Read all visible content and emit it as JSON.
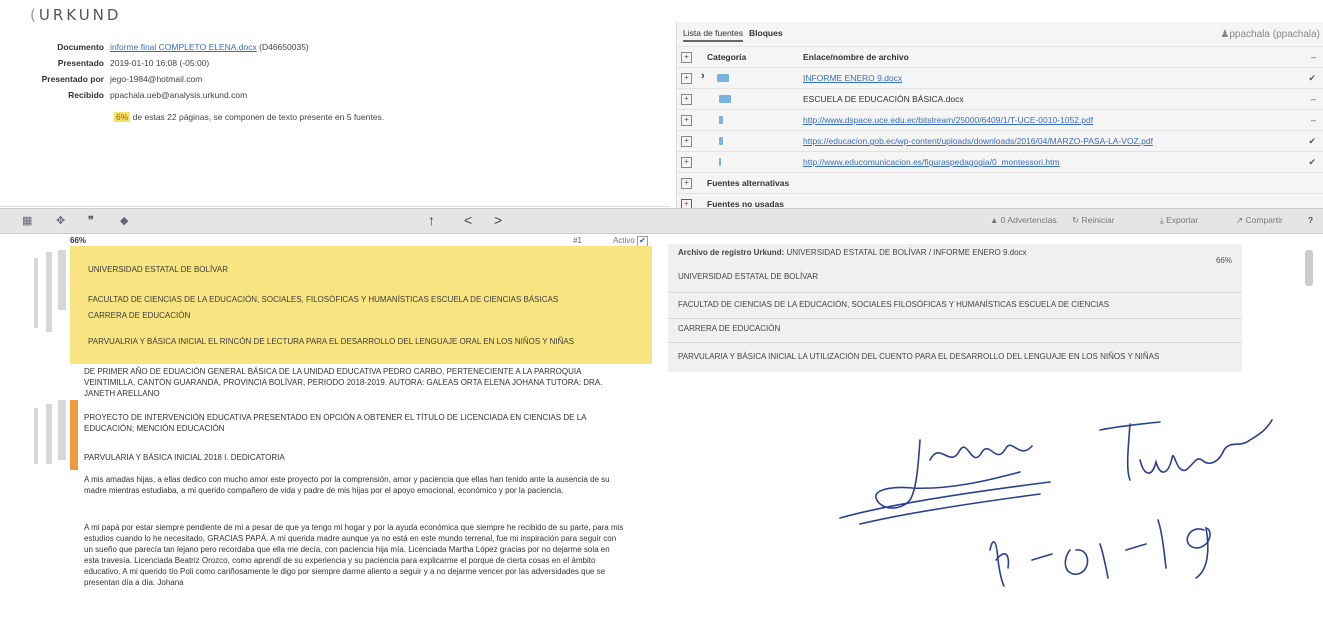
{
  "app": {
    "logo": "URKUND"
  },
  "meta": {
    "documento_label": "Documento",
    "documento_value": "informe final COMPLETO ELENA.docx",
    "documento_id": "(D46650035)",
    "presentado_label": "Presentado",
    "presentado_value": "2019-01-10 16:08 (-05:00)",
    "presentado_por_label": "Presentado por",
    "presentado_por_value": "jego-1984@hotmail.com",
    "recibido_label": "Recibido",
    "recibido_value": "ppachala.ueb@analysis.urkund.com",
    "summary_pct": "6%",
    "summary_text": "de estas 22 páginas, se componen de texto presente en 5 fuentes."
  },
  "sources": {
    "tab_list": "Lista de fuentes",
    "tab_blocks": "Bloques",
    "user": "ppachala (ppachala)",
    "col_category": "Categoría",
    "col_link": "Enlace/nombre de archivo",
    "rows": [
      {
        "name": "INFORME ENERO 9.docx",
        "mark": "✔"
      },
      {
        "name": "ESCUELA DE EDUCACIÓN BÁSICA.docx",
        "mark": "–"
      },
      {
        "name": "http://www.dspace.uce.edu.ec/bitstream/25000/6409/1/T-UCE-0010-1052.pdf",
        "mark": "–"
      },
      {
        "name": "https://educacion.gob.ec/wp-content/uploads/downloads/2016/04/MARZO-PASA-LA-VOZ.pdf",
        "mark": "✔"
      },
      {
        "name": "http://www.educomunicacion.es/figuraspedagogia/0_montessori.htm",
        "mark": "✔"
      }
    ],
    "alt_sources": "Fuentes alternativas",
    "unused_sources": "Fuentes no usadas"
  },
  "toolbar": {
    "warnings": "0 Advertencias.",
    "reset": "Reiniciar",
    "export": "Exportar",
    "share": "Compartir",
    "nav_up": "↑",
    "nav_prev": "<",
    "nav_next": ">"
  },
  "left_doc": {
    "match_pct": "66%",
    "match_num": "#1",
    "active_label": "Activo",
    "lines": [
      "UNIVERSIDAD ESTATAL DE BOLÍVAR",
      "FACULTAD DE CIENCIAS DE LA EDUCACIÓN, SOCIALES, FILOSÓFICAS Y HUMANÍSTICAS ESCUELA DE CIENCIAS BÁSICAS",
      "CARRERA DE EDUCACIÓN",
      "PARVUALRIA Y BÁSICA INICIAL EL RINCÓN DE LECTURA PARA EL DESARROLLO DEL LENGUAJE ORAL EN LOS NIÑOS Y NIÑAS"
    ],
    "para1": "DE PRIMER AÑO DE EDUACIÓN GENERAL BÁSICA DE LA UNIDAD EDUCATIVA PEDRO CARBO, PERTENECIENTE A LA PARROQUIA VEINTIMILLA, CANTÓN GUARANDA, PROVINCIA BOLÍVAR, PERIODO 2018-2019. AUTORA: GALEAS ORTA ELENA JOHANA TUTORA: DRA. JANETH ARELLANO",
    "para2": "PROYECTO DE INTERVENCIÓN EDUCATIVA PRESENTADO EN OPCIÓN A OBTENER EL TÍTULO DE LICENCIADA EN CIENCIAS DE LA EDUCACIÓN; MENCIÓN EDUCACIÓN",
    "para3": "PARVULARIA Y BÁSICA INICIAL 2018 I. DEDICATORIA",
    "para4": "A mis amadas hijas, a ellas dedico con mucho amor este proyecto por la comprensión, amor y paciencia que ellas han tenido ante la ausencia de su madre mientras estudiaba, a mi querido compañero de vida y padre de mis hijas por el apoyo emocional, económico y por la paciencia.",
    "para5": "A mi papá por estar siempre pendiente de mi a pesar de que ya tengo mi hogar y por la ayuda económica que siempre he recibido de su parte, para mis estudios cuando lo he necesitado, GRACIAS PAPÁ. A mi querida madre aunque ya no está en este mundo terrenal, fue mi inspiración para seguir con un sueño que parecía tan lejano pero recordaba que ella me decía, con paciencia hija mía. Licenciada Martha López gracias por no dejarme sola en esta travesía. Licenciada Beatriz Orozco, como aprendí de su experiencia y su paciencia para explicarme el porque de cierta cosas en el ámbito educativo. A mi querido tío Poli como cariñosamente le digo por siempre darme aliento a seguir y a no dejarme vencer por las adversidades que se presentan día a día. Johana"
  },
  "right_doc": {
    "header_label": "Archivo de registro Urkund:",
    "header_value": "UNIVERSIDAD ESTATAL DE BOLÍVAR / INFORME ENERO 9.docx",
    "pct": "66%",
    "lines": [
      "UNIVERSIDAD ESTATAL DE BOLÍVAR",
      "FACULTAD DE CIENCIAS DE LA EDUCACIÓN, SOCIALES FILOSÓFICAS Y HUMANÍSTICAS ESCUELA DE CIENCIAS",
      "CARRERA DE EDUCACIÓN",
      "PARVULARIA Y BÁSICA INICIAL LA UTILIZACIÓN DEL CUENTO PARA EL DESARROLLO DEL LENGUAJE EN LOS NIÑOS Y NIÑAS"
    ]
  },
  "handwriting": {
    "word": "Tutora",
    "date": "14-01-19"
  }
}
